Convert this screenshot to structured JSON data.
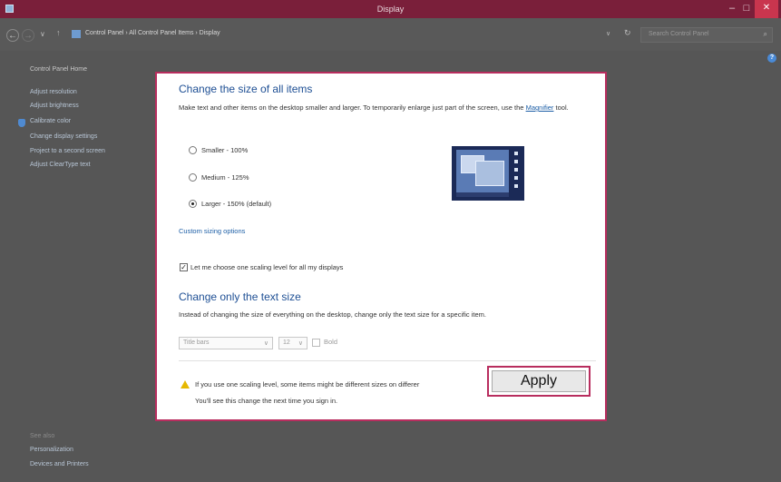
{
  "window": {
    "title": "Display",
    "controls": {
      "minimize": "–",
      "maximize": "□",
      "close": "✕"
    }
  },
  "address": {
    "back": "←",
    "forward": "→",
    "up": "↑",
    "breadcrumb": "Control Panel  ›  All Control Panel Items  ›  Display",
    "breadcrumb_arrow": "›",
    "dropdown": "∨",
    "refresh": "↻",
    "search_placeholder": "Search Control Panel",
    "search_icon": "⌕"
  },
  "sidebar": {
    "home": "Control Panel Home",
    "items": [
      "Adjust resolution",
      "Adjust brightness",
      "Calibrate color",
      "Change display settings",
      "Project to a second screen",
      "Adjust ClearType text"
    ],
    "see_also": {
      "heading": "See also",
      "items": [
        "Personalization",
        "Devices and Printers"
      ]
    }
  },
  "help": "?",
  "main": {
    "heading": "Change the size of all items",
    "desc_before_link": "Make text and other items on the desktop smaller and larger. To temporarily enlarge just part of the screen, use the ",
    "desc_link": "Magnifier",
    "desc_after_link": " tool.",
    "options": [
      {
        "label": "Smaller - 100%",
        "selected": false
      },
      {
        "label": "Medium - 125%",
        "selected": false
      },
      {
        "label": "Larger - 150% (default)",
        "selected": true
      }
    ],
    "custom_link": "Custom sizing options",
    "checkbox_label": "Let me choose one scaling level for all my displays",
    "checkbox_checked": true,
    "checkbox_mark": "✓",
    "text_heading": "Change only the text size",
    "text_desc": "Instead of changing the size of everything on the desktop, change only the text size for a specific item.",
    "item_select": "Title bars",
    "size_select": "12",
    "select_chevron": "∨",
    "bold_label": "Bold",
    "warning_line1": "If you use one scaling level, some items might be different sizes on differer",
    "warning_line2": "You'll see this change the next time you sign in.",
    "apply_label": "Apply"
  }
}
